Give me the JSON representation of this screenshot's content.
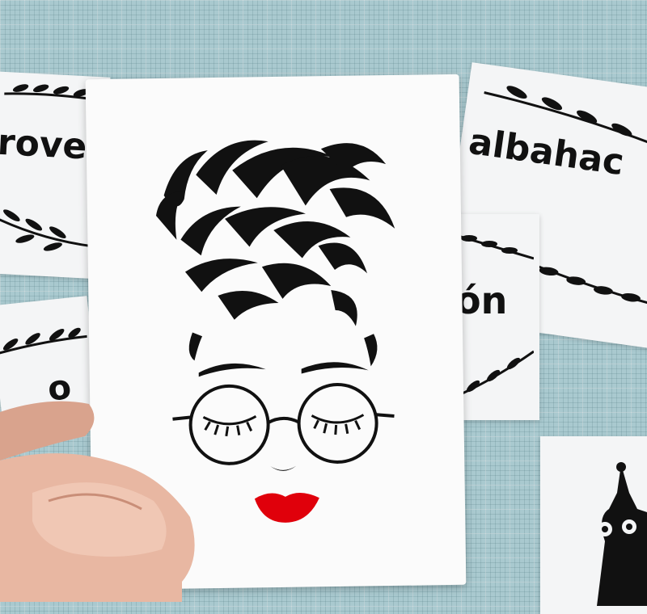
{
  "stickers": {
    "left_top_word": "rove",
    "right_word_1": "albahac",
    "right_word_2": "ón",
    "left_bottom_word": "o"
  },
  "icons": {
    "vine": "leafy-vine-icon",
    "cat": "cat-silhouette-icon",
    "face": "woman-face-with-glasses-illustration"
  },
  "colors": {
    "vinyl_black": "#111111",
    "lips_red": "#e0000b",
    "mat": "#a9c9cf"
  }
}
